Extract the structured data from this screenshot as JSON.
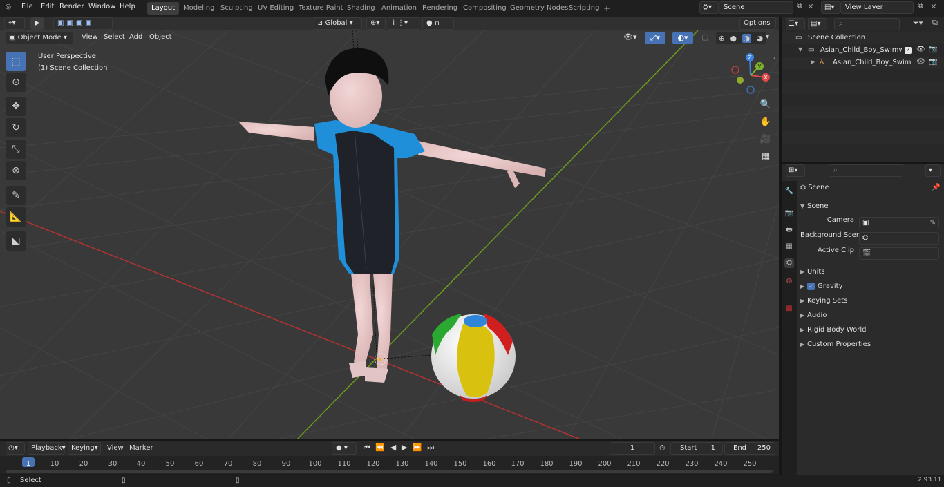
{
  "topbar": {
    "menus": [
      "File",
      "Edit",
      "Render",
      "Window",
      "Help"
    ],
    "workspaces": [
      "Layout",
      "Modeling",
      "Sculpting",
      "UV Editing",
      "Texture Paint",
      "Shading",
      "Animation",
      "Rendering",
      "Compositing",
      "Geometry Nodes",
      "Scripting"
    ],
    "active_workspace": "Layout",
    "add_tab": "+",
    "scene": "Scene",
    "view_layer": "View Layer"
  },
  "viewport_header": {
    "transform_orientation": "Global",
    "options": "Options",
    "mode": "Object Mode",
    "menus": [
      "View",
      "Select",
      "Add",
      "Object"
    ]
  },
  "viewport": {
    "perspective": "User Perspective",
    "collection": "(1) Scene Collection",
    "gizmo": {
      "x": "X",
      "y": "Y",
      "z": "Z"
    }
  },
  "outliner": {
    "root": "Scene Collection",
    "items": [
      "Asian_Child_Boy_Swimwear_",
      "Asian_Child_Boy_Swimw"
    ]
  },
  "properties": {
    "context": "Scene",
    "section": "Scene",
    "fields": [
      {
        "label": "Camera",
        "value": ""
      },
      {
        "label": "Background Scene",
        "value": ""
      },
      {
        "label": "Active Clip",
        "value": ""
      }
    ],
    "panels": [
      "Units",
      "Gravity",
      "Keying Sets",
      "Audio",
      "Rigid Body World",
      "Custom Properties"
    ],
    "gravity_checked": true
  },
  "timeline": {
    "menus": [
      "Playback",
      "Keying",
      "View",
      "Marker"
    ],
    "current_frame": "1",
    "start_label": "Start",
    "start": "1",
    "end_label": "End",
    "end": "250",
    "ticks": [
      "1",
      "10",
      "20",
      "30",
      "40",
      "50",
      "60",
      "70",
      "80",
      "90",
      "100",
      "110",
      "120",
      "130",
      "140",
      "150",
      "160",
      "170",
      "180",
      "190",
      "200",
      "210",
      "220",
      "230",
      "240",
      "250"
    ]
  },
  "statusbar": {
    "left": "Select",
    "version": "2.93.11"
  },
  "colors": {
    "accent": "#4772b3",
    "viewport_bg": "#393939",
    "x_axis": "#c83232",
    "y_axis": "#6b9b1e",
    "shirt_blue": "#1e8fd8",
    "suit_black": "#1f2228"
  }
}
